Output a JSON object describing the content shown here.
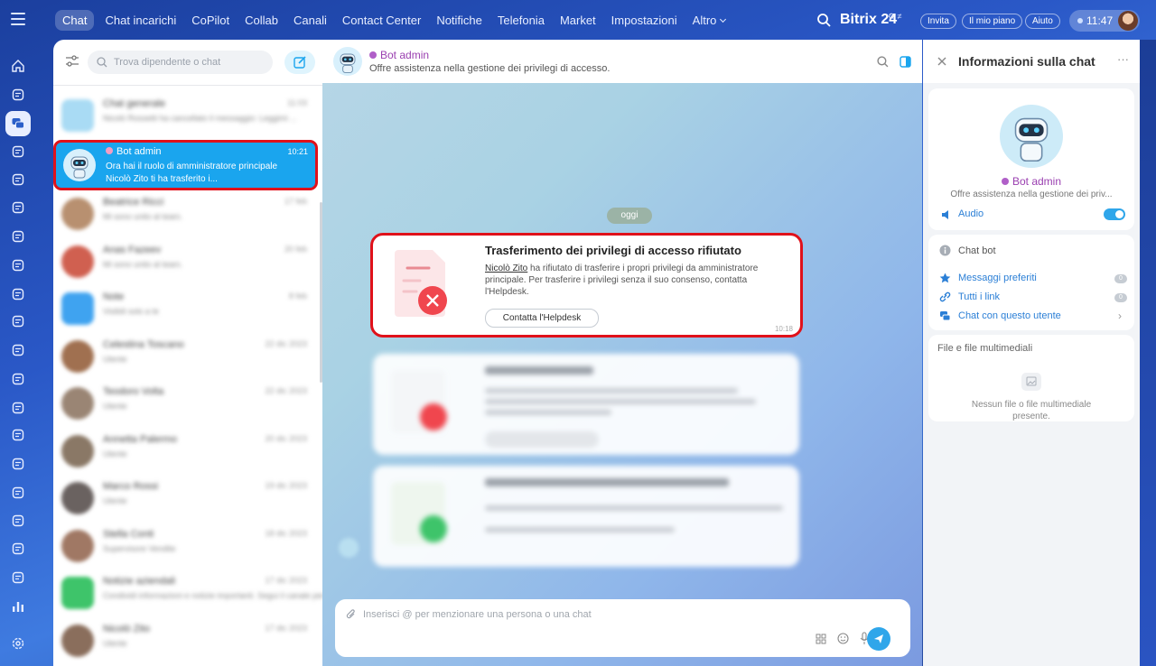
{
  "topbar": {
    "nav": [
      "Chat",
      "Chat incarichi",
      "CoPilot",
      "Collab",
      "Canali",
      "Contact Center",
      "Notifiche",
      "Telefonia",
      "Market",
      "Impostazioni",
      "Altro"
    ],
    "logo": "Bitrix 24",
    "invite_label": "Invita",
    "plan_label": "Il mio piano",
    "help_label": "Aiuto",
    "time": "11:47"
  },
  "rail": [
    "home-icon",
    "automation-icon",
    "chat-icon",
    "news-icon",
    "tasks-icon",
    "crm-icon",
    "calendar-icon",
    "documents-icon",
    "sites-icon",
    "inventory-icon",
    "mail-icon",
    "groups-icon",
    "employees-icon",
    "booking-icon",
    "store-icon",
    "marketing-icon",
    "shop-icon",
    "sign-icon",
    "edit-icon",
    "analytics-icon",
    "settings-icon"
  ],
  "chatlist": {
    "search_placeholder": "Trova dipendente o chat",
    "items_before": [
      {
        "name": "Chat generale",
        "time": "11:03",
        "preview": "Nicolò Rossetti ha cancellato il messaggio: Leggimi ..."
      }
    ],
    "selected": {
      "name": "Bot admin",
      "time": "10:21",
      "preview": "Ora hai il ruolo di amministratore principale Nicolò Zito ti ha trasferito i..."
    },
    "items_after": [
      {
        "name": "Beatrice Ricci",
        "time": "17 feb",
        "preview": "Mi sono unito al team.",
        "color": "#b89070"
      },
      {
        "name": "Anas Fazeev",
        "time": "20 feb",
        "preview": "Mi sono unito al team.",
        "color": "#d06050"
      },
      {
        "name": "Note",
        "time": "8 feb",
        "preview": "Visibili solo a te",
        "color": "#3fa3f0"
      },
      {
        "name": "Celestina Toscano",
        "time": "22 dic 2023",
        "preview": "Utente",
        "color": "#a07050"
      },
      {
        "name": "Teodoro Volta",
        "time": "22 dic 2023",
        "preview": "Utente",
        "color": "#9a8574"
      },
      {
        "name": "Annetta Palermo",
        "time": "20 dic 2023",
        "preview": "Utente",
        "color": "#8a7866"
      },
      {
        "name": "Marco Rossi",
        "time": "19 dic 2023",
        "preview": "Utente",
        "color": "#6a6260"
      },
      {
        "name": "Stella Conti",
        "time": "18 dic 2023",
        "preview": "Supervisore Vendite",
        "color": "#a07864"
      },
      {
        "name": "Notizie aziendali",
        "time": "17 dic 2023",
        "preview": "Condividi informazioni e notizie importanti. Segui il canale per restare al...",
        "color": "#3ec46a"
      },
      {
        "name": "Nicolò Zito",
        "time": "17 dic 2023",
        "preview": "Utente",
        "color": "#8a6e5c"
      }
    ]
  },
  "chat": {
    "title": "Bot admin",
    "subtitle": "Offre assistenza nella gestione dei privilegi di accesso.",
    "day": "oggi",
    "message": {
      "title": "Trasferimento dei privilegi di accesso rifiutato",
      "user": "Nicolò Zito",
      "body": " ha rifiutato di trasferire i propri privilegi da amministratore principale. Per trasferire i privilegi senza il suo consenso, contatta l'Helpdesk.",
      "button": "Contatta l'Helpdesk",
      "time": "10:18"
    },
    "input_placeholder": "Inserisci @ per menzionare una persona o una chat"
  },
  "info": {
    "title": "Informazioni sulla chat",
    "name": "Bot admin",
    "desc": "Offre assistenza nella gestione dei priv...",
    "audio_label": "Audio",
    "audio_on": true,
    "type_label": "Chat bot",
    "favorites_label": "Messaggi preferiti",
    "favorites_count": "0",
    "links_label": "Tutti i link",
    "links_count": "0",
    "chat_with_label": "Chat con questo utente",
    "files_title": "File e file multimediali",
    "files_empty": "Nessun file o file multimediale presente."
  }
}
